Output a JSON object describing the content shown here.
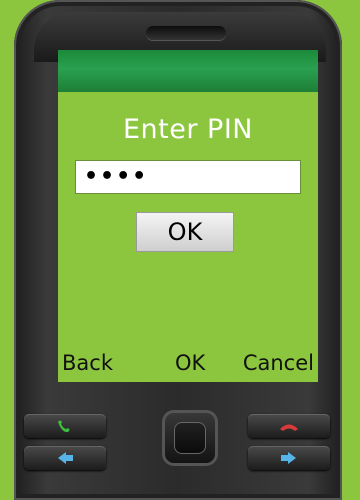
{
  "screen": {
    "title": "Enter PIN",
    "pin_value": "••••",
    "ok_button_label": "OK"
  },
  "softkeys": {
    "left": "Back",
    "center": "OK",
    "right": "Cancel"
  },
  "icons": {
    "call": "call-icon",
    "end_call": "end-call-icon",
    "left_arrow": "arrow-left-icon",
    "right_arrow": "arrow-right-icon"
  },
  "colors": {
    "background": "#8cc63f",
    "status_bar": "#1b8a3a",
    "call_green": "#3cbf3c",
    "end_red": "#d83a3a",
    "arrow_blue": "#56b4e8"
  }
}
